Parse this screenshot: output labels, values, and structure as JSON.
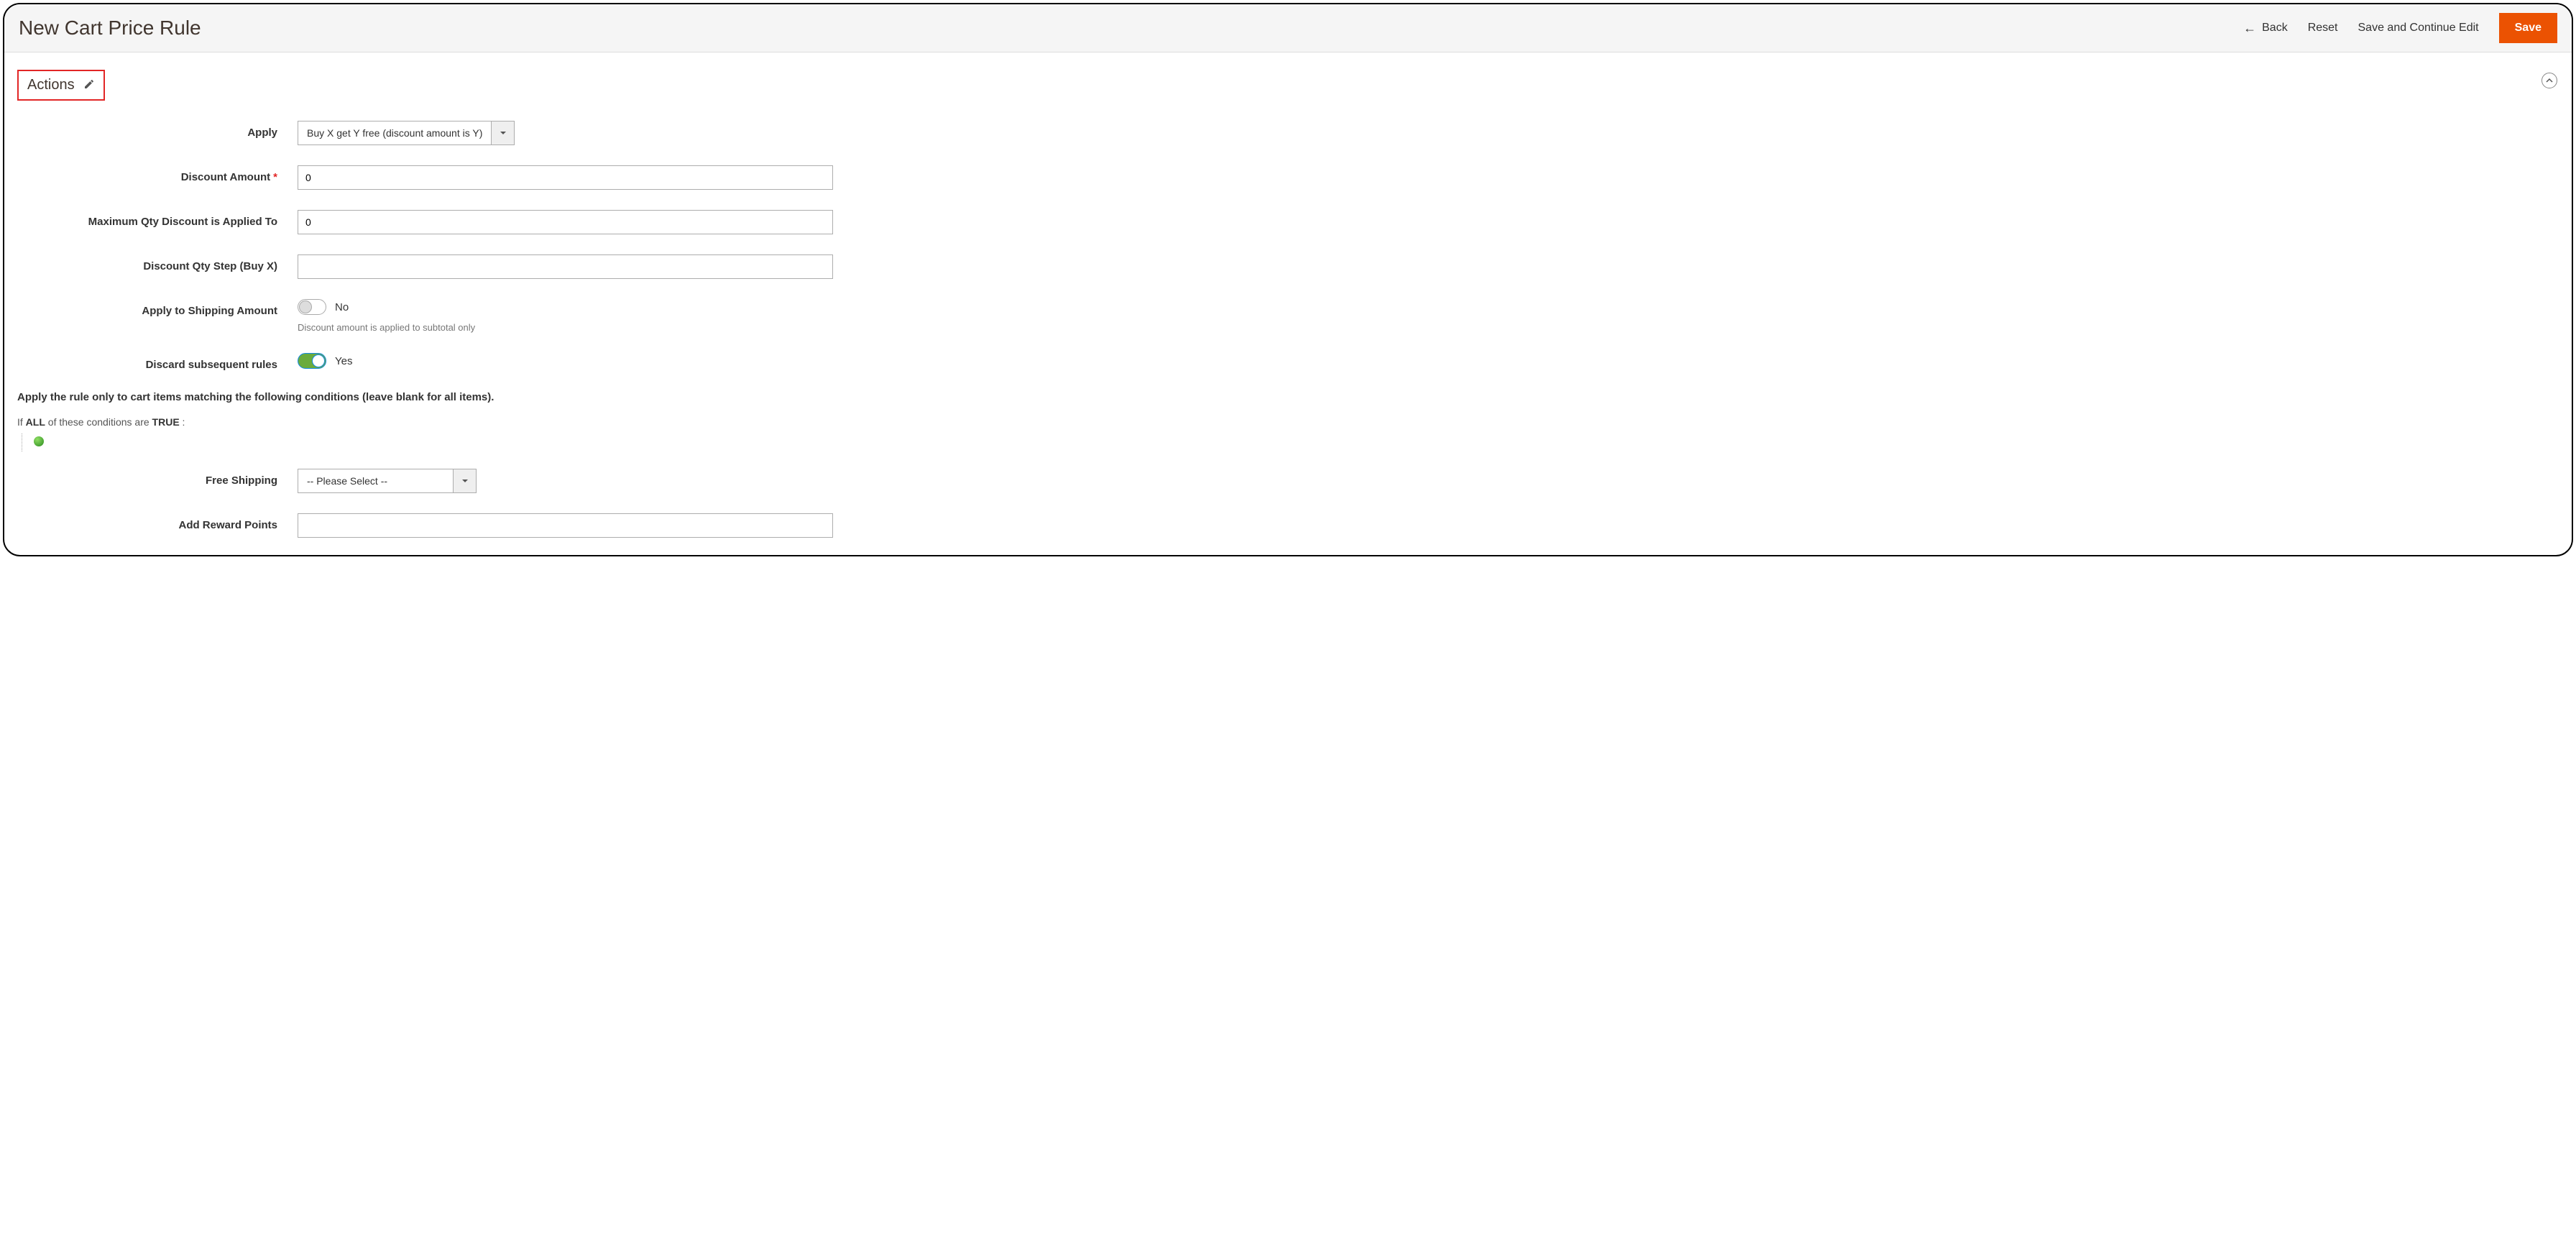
{
  "header": {
    "title": "New Cart Price Rule",
    "back": "Back",
    "reset": "Reset",
    "save_continue": "Save and Continue Edit",
    "save": "Save"
  },
  "section": {
    "title": "Actions"
  },
  "form": {
    "apply": {
      "label": "Apply",
      "value": "Buy X get Y free (discount amount is Y)"
    },
    "discount_amount": {
      "label": "Discount Amount",
      "value": "0",
      "required": true
    },
    "max_qty": {
      "label": "Maximum Qty Discount is Applied To",
      "value": "0"
    },
    "qty_step": {
      "label": "Discount Qty Step (Buy X)",
      "value": ""
    },
    "apply_shipping": {
      "label": "Apply to Shipping Amount",
      "value": "No",
      "help": "Discount amount is applied to subtotal only"
    },
    "discard_rules": {
      "label": "Discard subsequent rules",
      "value": "Yes"
    },
    "rules_heading": "Apply the rule only to cart items matching the following conditions (leave blank for all items).",
    "cond_prefix": "If ",
    "cond_all": "ALL",
    "cond_middle": "  of these conditions are ",
    "cond_true": "TRUE",
    "cond_suffix": " :",
    "free_shipping": {
      "label": "Free Shipping",
      "value": "-- Please Select --"
    },
    "reward_points": {
      "label": "Add Reward Points",
      "value": ""
    }
  }
}
